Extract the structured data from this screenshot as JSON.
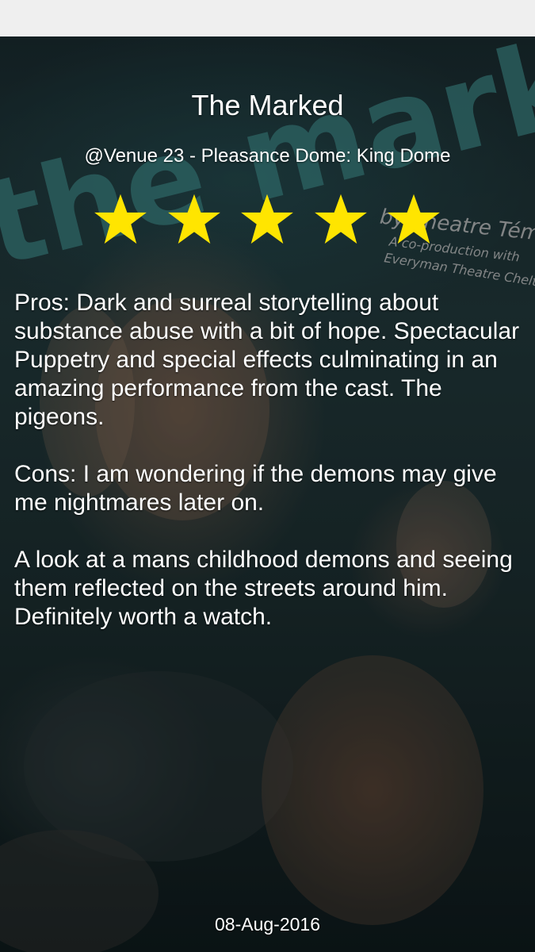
{
  "review": {
    "title": "The Marked",
    "venue": "@Venue 23 - Pleasance Dome: King Dome",
    "rating": 5,
    "rating_max": 5,
    "star_color": "#ffe500",
    "pros": "Pros: Dark and surreal storytelling about substance abuse with a bit of hope. Spectacular Puppetry and special effects culminating in an amazing performance from the cast. The pigeons.",
    "cons": "Cons: I am wondering if the demons may give me nightmares later on.",
    "summary": "A look at a mans childhood demons and seeing them reflected on the streets around him. Definitely worth a watch.",
    "date": "08-Aug-2016"
  },
  "poster": {
    "title_text": "the marked",
    "byline": "by Theatre Témoin",
    "credit_line1": "A co-production with",
    "credit_line2": "Everyman Theatre Cheltenham"
  }
}
